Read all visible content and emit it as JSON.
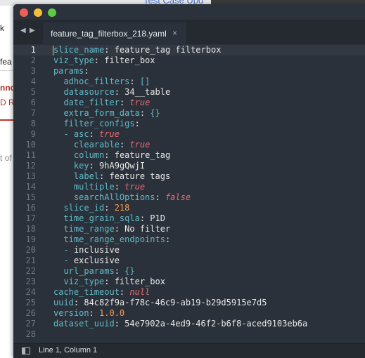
{
  "background_app": {
    "link_text": "Test Case Upd",
    "fragments": [
      "k",
      "fea",
      "nno",
      "D R",
      "t of"
    ]
  },
  "window": {
    "nav_back": "◀",
    "nav_forward": "▶",
    "tab": {
      "title": "feature_tag_filterbox_218.yaml",
      "close": "×"
    },
    "status": {
      "position": "Line 1, Column 1"
    },
    "colors": {
      "background": "#2b313a",
      "key": "#5fbcc9",
      "boolean": "#e86a74",
      "number": "#f39b55"
    }
  },
  "editor": {
    "lines": [
      {
        "num": "1",
        "segments": [
          {
            "c": "k",
            "t": "slice_name"
          },
          {
            "c": "t",
            "t": ": feature_tag filterbox"
          }
        ]
      },
      {
        "num": "2",
        "segments": [
          {
            "c": "k",
            "t": "viz_type"
          },
          {
            "c": "t",
            "t": ": filter_box"
          }
        ]
      },
      {
        "num": "3",
        "segments": [
          {
            "c": "k",
            "t": "params"
          },
          {
            "c": "t",
            "t": ":"
          }
        ]
      },
      {
        "num": "4",
        "segments": [
          {
            "c": "t",
            "t": "  "
          },
          {
            "c": "k",
            "t": "adhoc_filters"
          },
          {
            "c": "t",
            "t": ": "
          },
          {
            "c": "k",
            "t": "[]"
          }
        ]
      },
      {
        "num": "5",
        "segments": [
          {
            "c": "t",
            "t": "  "
          },
          {
            "c": "k",
            "t": "datasource"
          },
          {
            "c": "t",
            "t": ": 34__table"
          }
        ]
      },
      {
        "num": "6",
        "segments": [
          {
            "c": "t",
            "t": "  "
          },
          {
            "c": "k",
            "t": "date_filter"
          },
          {
            "c": "t",
            "t": ": "
          },
          {
            "c": "b",
            "t": "true"
          }
        ]
      },
      {
        "num": "7",
        "segments": [
          {
            "c": "t",
            "t": "  "
          },
          {
            "c": "k",
            "t": "extra_form_data"
          },
          {
            "c": "t",
            "t": ": "
          },
          {
            "c": "k",
            "t": "{}"
          }
        ]
      },
      {
        "num": "8",
        "segments": [
          {
            "c": "t",
            "t": "  "
          },
          {
            "c": "k",
            "t": "filter_configs"
          },
          {
            "c": "t",
            "t": ":"
          }
        ]
      },
      {
        "num": "9",
        "segments": [
          {
            "c": "t",
            "t": "  "
          },
          {
            "c": "k",
            "t": "- asc"
          },
          {
            "c": "t",
            "t": ": "
          },
          {
            "c": "b",
            "t": "true"
          }
        ]
      },
      {
        "num": "10",
        "segments": [
          {
            "c": "t",
            "t": "    "
          },
          {
            "c": "k",
            "t": "clearable"
          },
          {
            "c": "t",
            "t": ": "
          },
          {
            "c": "b",
            "t": "true"
          }
        ]
      },
      {
        "num": "11",
        "segments": [
          {
            "c": "t",
            "t": "    "
          },
          {
            "c": "k",
            "t": "column"
          },
          {
            "c": "t",
            "t": ": feature_tag"
          }
        ]
      },
      {
        "num": "12",
        "segments": [
          {
            "c": "t",
            "t": "    "
          },
          {
            "c": "k",
            "t": "key"
          },
          {
            "c": "t",
            "t": ": 9hA9gQwjI"
          }
        ]
      },
      {
        "num": "13",
        "segments": [
          {
            "c": "t",
            "t": "    "
          },
          {
            "c": "k",
            "t": "label"
          },
          {
            "c": "t",
            "t": ": feature tags"
          }
        ]
      },
      {
        "num": "14",
        "segments": [
          {
            "c": "t",
            "t": "    "
          },
          {
            "c": "k",
            "t": "multiple"
          },
          {
            "c": "t",
            "t": ": "
          },
          {
            "c": "b",
            "t": "true"
          }
        ]
      },
      {
        "num": "15",
        "segments": [
          {
            "c": "t",
            "t": "    "
          },
          {
            "c": "k",
            "t": "searchAllOptions"
          },
          {
            "c": "t",
            "t": ": "
          },
          {
            "c": "b",
            "t": "false"
          }
        ]
      },
      {
        "num": "16",
        "segments": [
          {
            "c": "t",
            "t": "  "
          },
          {
            "c": "k",
            "t": "slice_id"
          },
          {
            "c": "t",
            "t": ": "
          },
          {
            "c": "n",
            "t": "218"
          }
        ]
      },
      {
        "num": "17",
        "segments": [
          {
            "c": "t",
            "t": "  "
          },
          {
            "c": "k",
            "t": "time_grain_sqla"
          },
          {
            "c": "t",
            "t": ": P1D"
          }
        ]
      },
      {
        "num": "18",
        "segments": [
          {
            "c": "t",
            "t": "  "
          },
          {
            "c": "k",
            "t": "time_range"
          },
          {
            "c": "t",
            "t": ": No filter"
          }
        ]
      },
      {
        "num": "19",
        "segments": [
          {
            "c": "t",
            "t": "  "
          },
          {
            "c": "k",
            "t": "time_range_endpoints"
          },
          {
            "c": "t",
            "t": ":"
          }
        ]
      },
      {
        "num": "20",
        "segments": [
          {
            "c": "t",
            "t": "  "
          },
          {
            "c": "k",
            "t": "- "
          },
          {
            "c": "t",
            "t": "inclusive"
          }
        ]
      },
      {
        "num": "21",
        "segments": [
          {
            "c": "t",
            "t": "  "
          },
          {
            "c": "k",
            "t": "- "
          },
          {
            "c": "t",
            "t": "exclusive"
          }
        ]
      },
      {
        "num": "22",
        "segments": [
          {
            "c": "t",
            "t": "  "
          },
          {
            "c": "k",
            "t": "url_params"
          },
          {
            "c": "t",
            "t": ": "
          },
          {
            "c": "k",
            "t": "{}"
          }
        ]
      },
      {
        "num": "23",
        "segments": [
          {
            "c": "t",
            "t": "  "
          },
          {
            "c": "k",
            "t": "viz_type"
          },
          {
            "c": "t",
            "t": ": filter_box"
          }
        ]
      },
      {
        "num": "24",
        "segments": [
          {
            "c": "k",
            "t": "cache_timeout"
          },
          {
            "c": "t",
            "t": ": "
          },
          {
            "c": "b",
            "t": "null"
          }
        ]
      },
      {
        "num": "25",
        "segments": [
          {
            "c": "k",
            "t": "uuid"
          },
          {
            "c": "t",
            "t": ": 84c82f9a-f78c-46c9-ab19-b29d5915e7d5"
          }
        ]
      },
      {
        "num": "26",
        "segments": [
          {
            "c": "k",
            "t": "version"
          },
          {
            "c": "t",
            "t": ": "
          },
          {
            "c": "n",
            "t": "1.0.0"
          }
        ]
      },
      {
        "num": "27",
        "segments": [
          {
            "c": "k",
            "t": "dataset_uuid"
          },
          {
            "c": "t",
            "t": ": 54e7902a-4ed9-46f2-b6f8-aced9103eb6a"
          }
        ]
      },
      {
        "num": "28",
        "segments": []
      }
    ]
  }
}
